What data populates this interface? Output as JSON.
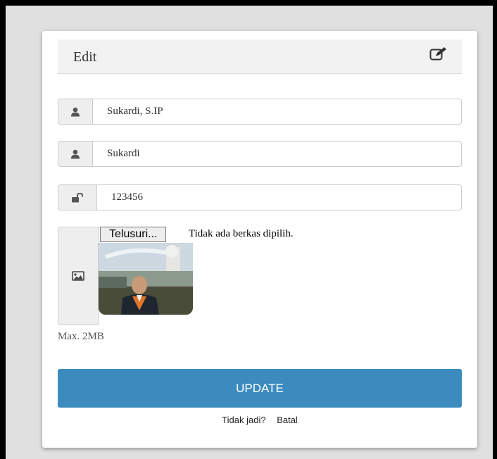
{
  "panel": {
    "title": "Edit",
    "icon": "edit-square-icon"
  },
  "fields": {
    "full_name": {
      "value": "Sukardi, S.IP",
      "icon": "user-icon"
    },
    "username": {
      "value": "Sukardi",
      "icon": "user-icon"
    },
    "password": {
      "value": "123456",
      "icon": "unlock-icon"
    }
  },
  "upload": {
    "icon": "image-icon",
    "browse_label": "Telusuri...",
    "status": "Tidak ada berkas dipilih.",
    "note": "Max. 2MB"
  },
  "actions": {
    "update_label": "UPDATE",
    "cancel_question": "Tidak jadi?",
    "cancel_link": "Batal"
  },
  "colors": {
    "primary": "#3c8bbf",
    "panel_header": "#f2f2f2",
    "addon_bg": "#eeeeee"
  }
}
